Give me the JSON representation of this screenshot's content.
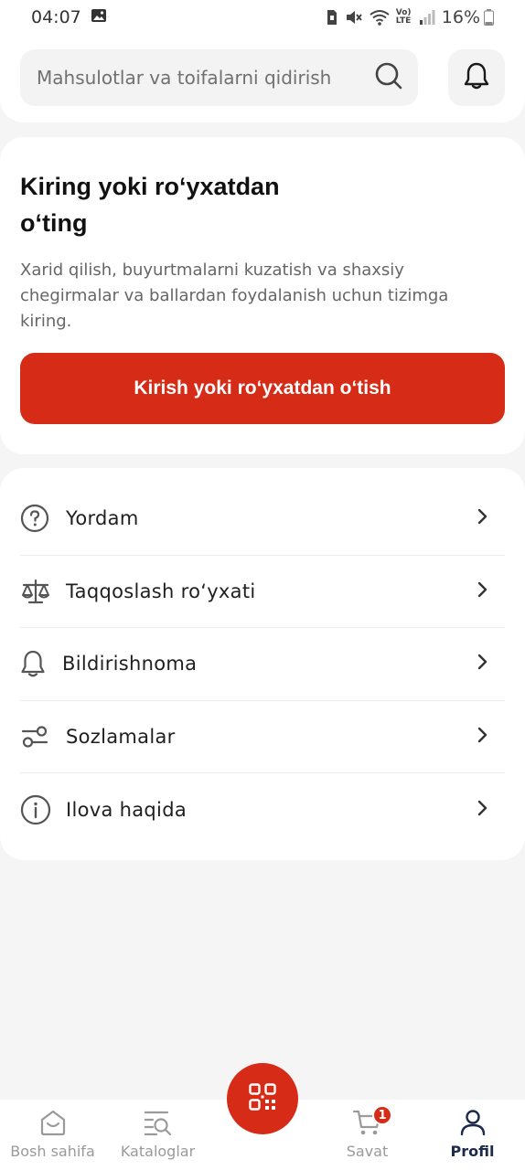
{
  "status_bar": {
    "time": "04:07",
    "battery": "16%",
    "network_label": "Vo) LTE"
  },
  "search": {
    "placeholder": "Mahsulotlar va toifalarni qidirish",
    "search_icon": "search-icon",
    "notifications_icon": "bell-icon"
  },
  "login_card": {
    "title": "Kiring yoki ro‘yxatdan o‘ting",
    "description": "Xarid qilish, buyurtmalarni kuzatish va shaxsiy chegirmalar va ballardan foydalanish uchun tizimga kiring.",
    "button_label": "Kirish yoki ro‘yxatdan o‘tish"
  },
  "menu": {
    "items": [
      {
        "label": "Yordam",
        "icon": "help-icon"
      },
      {
        "label": "Taqqoslash ro‘yxati",
        "icon": "scales-icon"
      },
      {
        "label": "Bildirishnoma",
        "icon": "bell-icon"
      },
      {
        "label": "Sozlamalar",
        "icon": "sliders-icon"
      },
      {
        "label": "Ilova haqida",
        "icon": "info-icon"
      }
    ]
  },
  "bottom_nav": {
    "home": "Bosh sahifa",
    "catalog": "Kataloglar",
    "cart": "Savat",
    "cart_badge": "1",
    "profile": "Profil",
    "active": "profile"
  },
  "colors": {
    "accent": "#d62b16",
    "active_nav": "#1c2b4a",
    "inactive_nav": "#9a9a9a",
    "background": "#f5f5f5"
  }
}
